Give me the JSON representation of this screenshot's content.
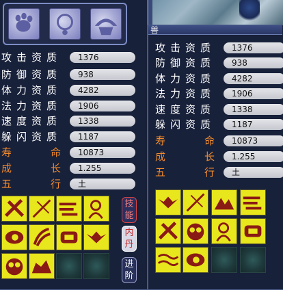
{
  "left_panel": {
    "portraits": [
      "paw-icon",
      "necklace-icon",
      "armor-icon"
    ],
    "stats": [
      {
        "label": "攻击资质",
        "value": "1376"
      },
      {
        "label": "防御资质",
        "value": "938"
      },
      {
        "label": "体力资质",
        "value": "4282"
      },
      {
        "label": "法力资质",
        "value": "1906"
      },
      {
        "label": "速度资质",
        "value": "1338"
      },
      {
        "label": "躲闪资质",
        "value": "1187"
      }
    ],
    "special": [
      {
        "label_a": "寿",
        "label_b": "命",
        "value": "10873"
      },
      {
        "label_a": "成",
        "label_b": "长",
        "value": "1.255"
      },
      {
        "label_a": "五",
        "label_b": "行",
        "value": "土"
      }
    ],
    "buttons": {
      "skills": "技能",
      "neidan": "内丹",
      "advance": "进阶"
    }
  },
  "right_panel": {
    "title": "兽",
    "stats": [
      {
        "label": "攻击资质",
        "value": "1376"
      },
      {
        "label": "防御资质",
        "value": "938"
      },
      {
        "label": "体力资质",
        "value": "4282"
      },
      {
        "label": "法力资质",
        "value": "1906"
      },
      {
        "label": "速度资质",
        "value": "1338"
      },
      {
        "label": "躲闪资质",
        "value": "1187"
      }
    ],
    "special": [
      {
        "label_a": "寿",
        "label_b": "命",
        "value": "10873"
      },
      {
        "label_a": "成",
        "label_b": "长",
        "value": "1.255"
      },
      {
        "label_a": "五",
        "label_b": "行",
        "value": "土"
      }
    ]
  },
  "colors": {
    "label_orange": "#f28a2c",
    "skill_yellow": "#e8e61c",
    "skill_red": "#8a1a14"
  }
}
